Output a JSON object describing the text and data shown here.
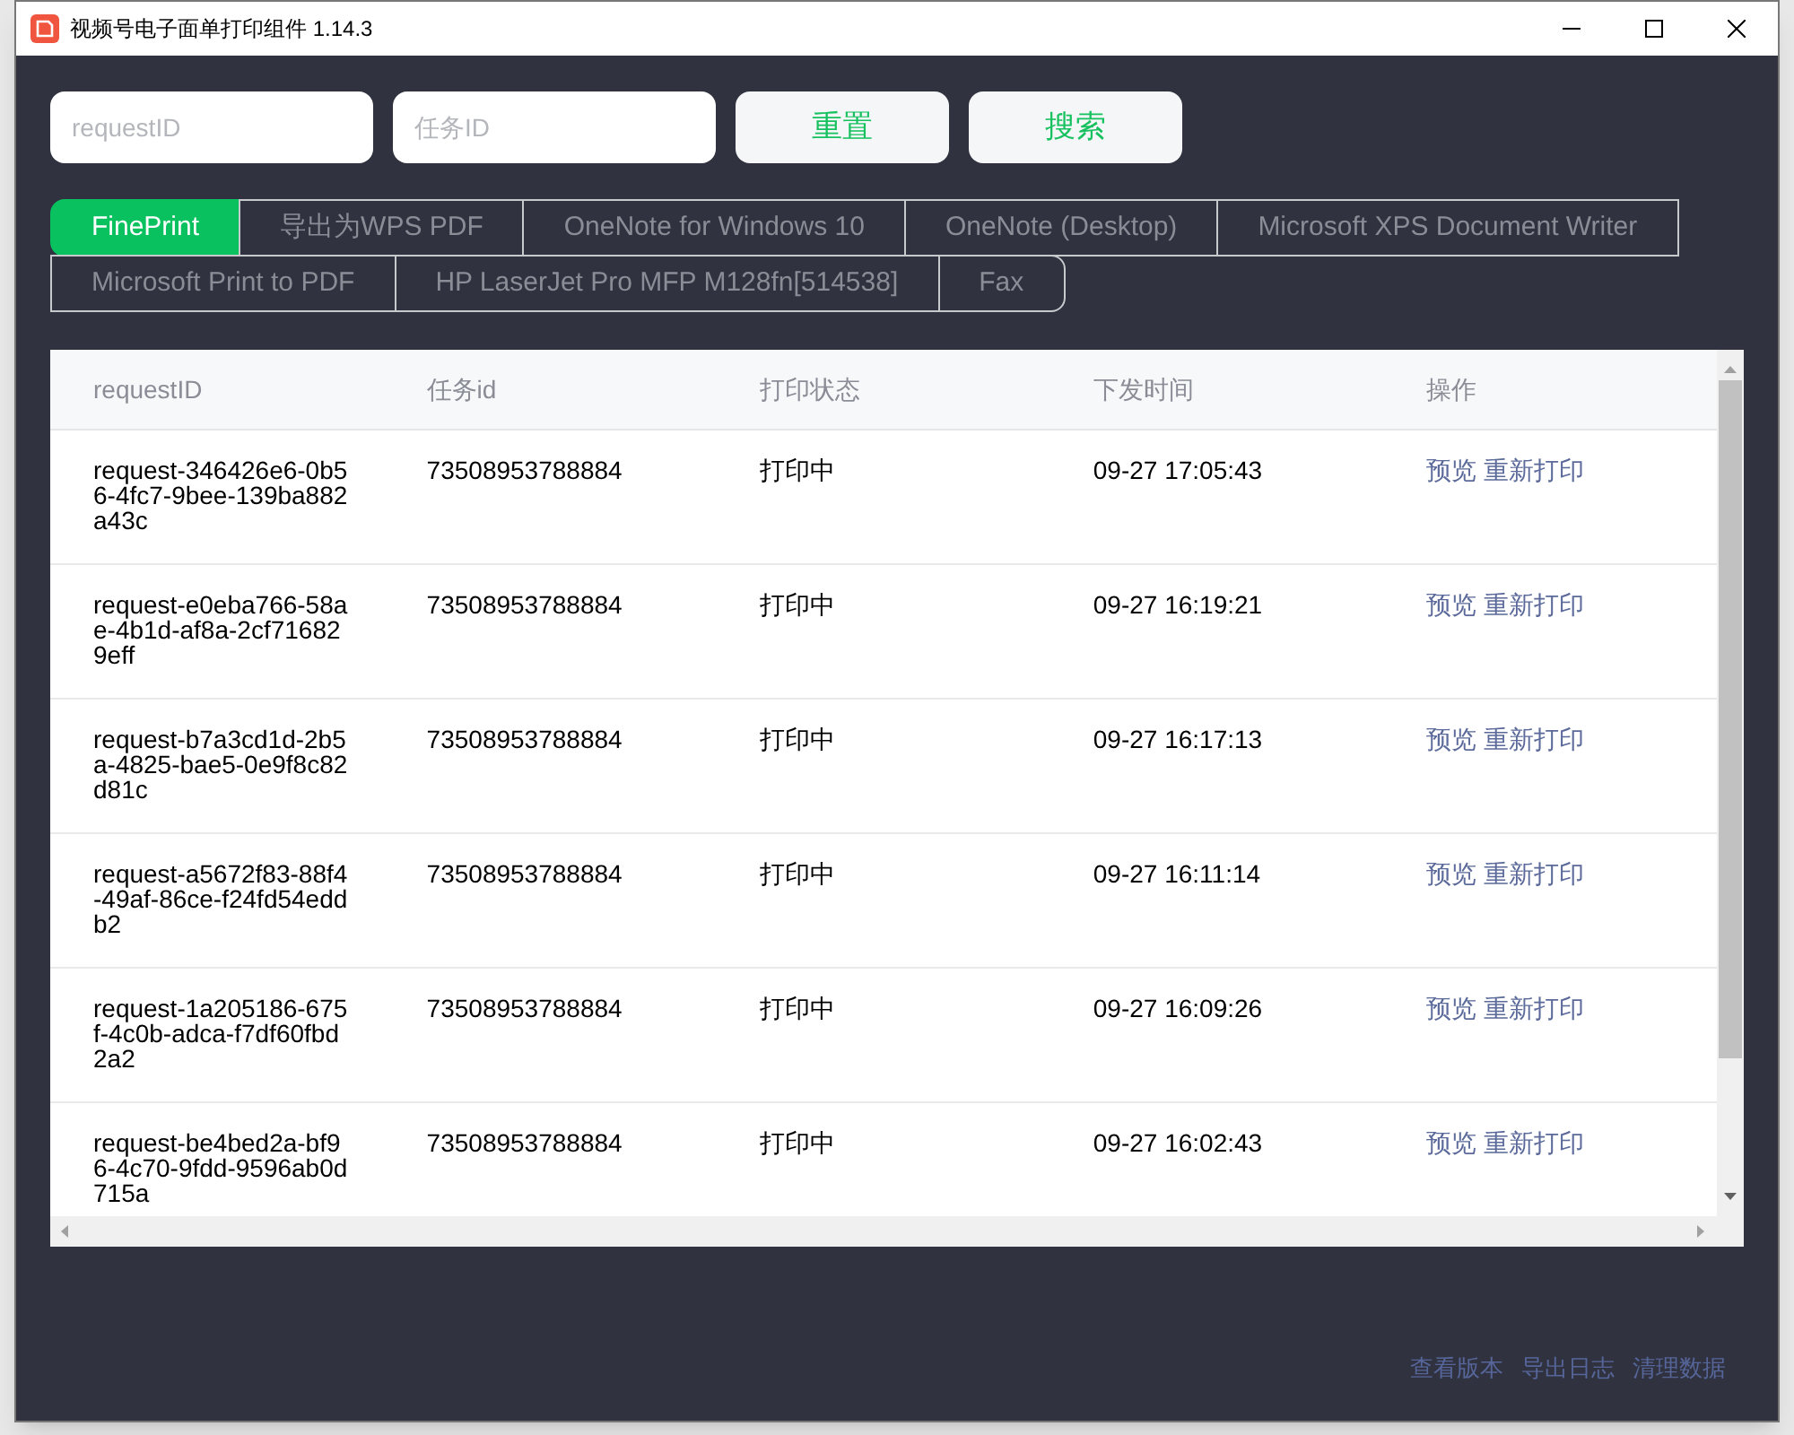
{
  "window": {
    "title": "视频号电子面单打印组件 1.14.3"
  },
  "search": {
    "fields": [
      {
        "placeholder": "requestID"
      },
      {
        "placeholder": "任务ID"
      }
    ],
    "buttons": [
      "重置",
      "搜索"
    ]
  },
  "printer_tabs": [
    {
      "label": "FinePrint",
      "selected": true
    },
    {
      "label": "导出为WPS PDF",
      "selected": false
    },
    {
      "label": "OneNote for Windows 10",
      "selected": false
    },
    {
      "label": "OneNote (Desktop)",
      "selected": false
    },
    {
      "label": "Microsoft XPS Document Writer",
      "selected": false
    },
    {
      "label": "Microsoft Print to PDF",
      "selected": false
    },
    {
      "label": "HP LaserJet Pro MFP M128fn[514538]",
      "selected": false
    },
    {
      "label": "Fax",
      "selected": false
    }
  ],
  "table": {
    "columns": [
      "requestID",
      "任务id",
      "打印状态",
      "下发时间",
      "操作"
    ],
    "rows": [
      {
        "request_id": "request-346426e6-0b56-4fc7-9bee-139ba882a43c",
        "task_id": "73508953788884",
        "status": "打印中",
        "time": "09-27 17:05:43",
        "actions": [
          "预览",
          "重新打印"
        ]
      },
      {
        "request_id": "request-e0eba766-58ae-4b1d-af8a-2cf716829eff",
        "task_id": "73508953788884",
        "status": "打印中",
        "time": "09-27 16:19:21",
        "actions": [
          "预览",
          "重新打印"
        ]
      },
      {
        "request_id": "request-b7a3cd1d-2b5a-4825-bae5-0e9f8c82d81c",
        "task_id": "73508953788884",
        "status": "打印中",
        "time": "09-27 16:17:13",
        "actions": [
          "预览",
          "重新打印"
        ]
      },
      {
        "request_id": "request-a5672f83-88f4-49af-86ce-f24fd54eddb2",
        "task_id": "73508953788884",
        "status": "打印中",
        "time": "09-27 16:11:14",
        "actions": [
          "预览",
          "重新打印"
        ]
      },
      {
        "request_id": "request-1a205186-675f-4c0b-adca-f7df60fbd2a2",
        "task_id": "73508953788884",
        "status": "打印中",
        "time": "09-27 16:09:26",
        "actions": [
          "预览",
          "重新打印"
        ]
      },
      {
        "request_id": "request-be4bed2a-bf96-4c70-9fdd-9596ab0d715a",
        "task_id": "73508953788884",
        "status": "打印中",
        "time": "09-27 16:02:43",
        "actions": [
          "预览",
          "重新打印"
        ]
      }
    ]
  },
  "footer_links": [
    "查看版本",
    "导出日志",
    "清理数据"
  ]
}
